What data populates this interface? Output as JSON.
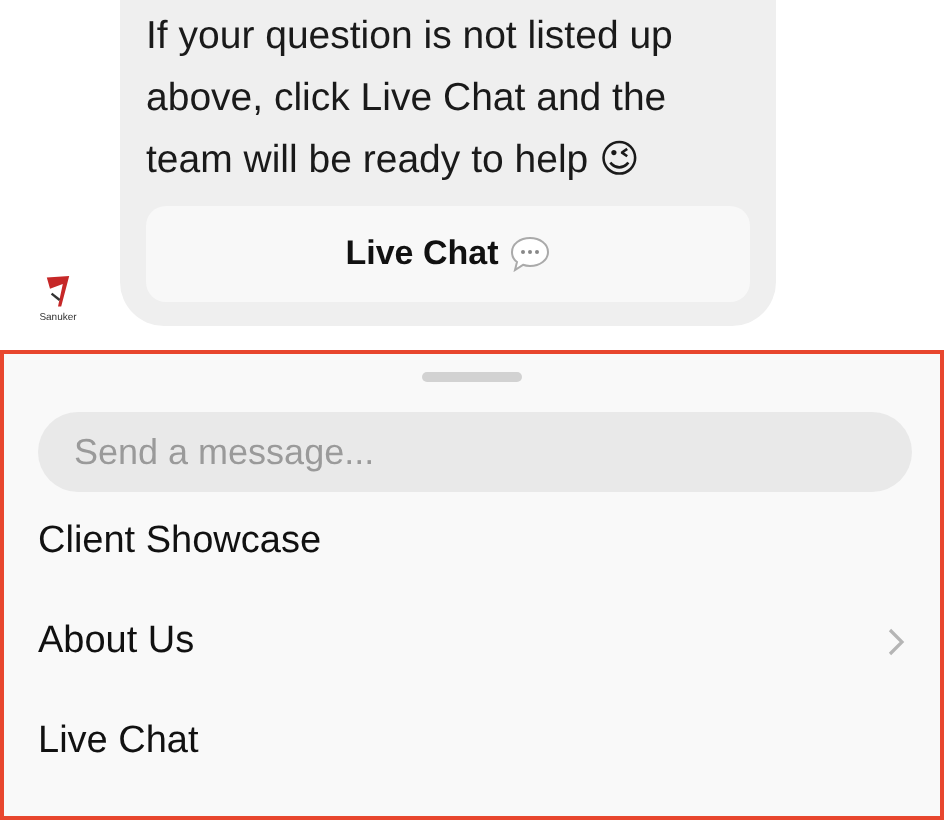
{
  "message": {
    "text": "If your question is not listed up above, click Live Chat and the team will be ready to help 😉",
    "button": "Live Chat"
  },
  "avatar": {
    "caption": "Sanuker"
  },
  "composer": {
    "placeholder": "Send a message..."
  },
  "menu": [
    {
      "label": "Client Showcase",
      "has_submenu": false
    },
    {
      "label": "About Us",
      "has_submenu": true
    },
    {
      "label": "Live Chat",
      "has_submenu": false
    }
  ]
}
